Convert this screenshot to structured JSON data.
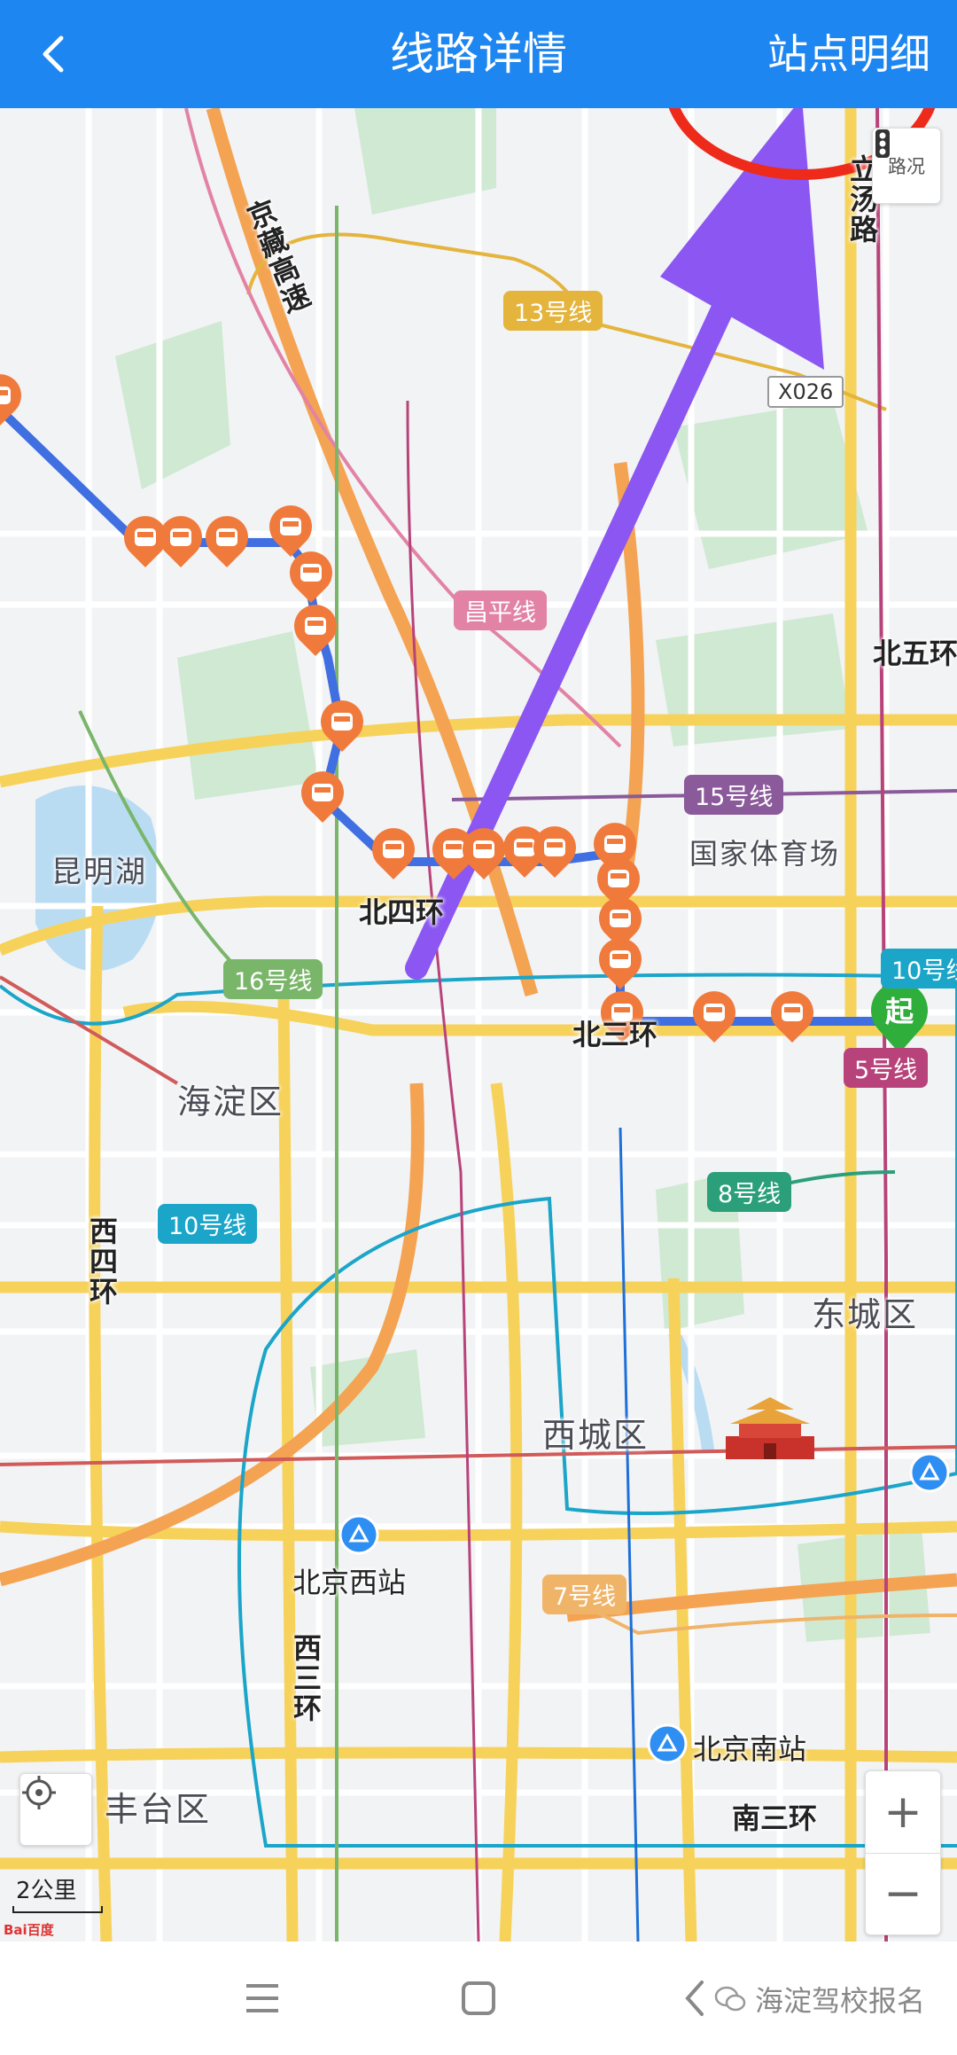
{
  "header": {
    "title": "线路详情",
    "right_action": "站点明细",
    "back_icon": "chevron-left-icon",
    "background": "#1e86f0"
  },
  "map": {
    "districts": [
      "海淀区",
      "东城区",
      "西城区",
      "丰台区",
      "昆明湖",
      "国家体育场"
    ],
    "roads": [
      "京藏高速",
      "立汤路",
      "北五环",
      "北四环",
      "北三环",
      "西四环",
      "西三环",
      "南三环"
    ],
    "road_badge": "X026",
    "stations": [
      "北京西站",
      "北京南站"
    ],
    "subway_lines": [
      {
        "name": "13号线",
        "color": "#e4b43c"
      },
      {
        "name": "昌平线",
        "color": "#e283a5"
      },
      {
        "name": "15号线",
        "color": "#8a5a9a"
      },
      {
        "name": "16号线",
        "color": "#7ab66a"
      },
      {
        "name": "10号线",
        "color": "#1ba5c9"
      },
      {
        "name": "5号线",
        "color": "#b8437a"
      },
      {
        "name": "8号线",
        "color": "#2b9f7a"
      },
      {
        "name": "7号线",
        "color": "#f0b469"
      }
    ],
    "start_marker": "起",
    "traffic_label": "路况",
    "scale_label": "2公里",
    "logo_text": "Bai百度",
    "zoom_in": "+",
    "zoom_out": "−",
    "route_color": "#3f6fe0",
    "stop_color": "#f07a3c",
    "annotation_color": "#8b56f2",
    "highlight_color": "#ee2a1b"
  },
  "nav": {
    "menu_icon": "menu-icon",
    "home_icon": "home-square-icon",
    "back_icon": "back-chevron-icon",
    "watermark": "海淀驾校报名"
  }
}
